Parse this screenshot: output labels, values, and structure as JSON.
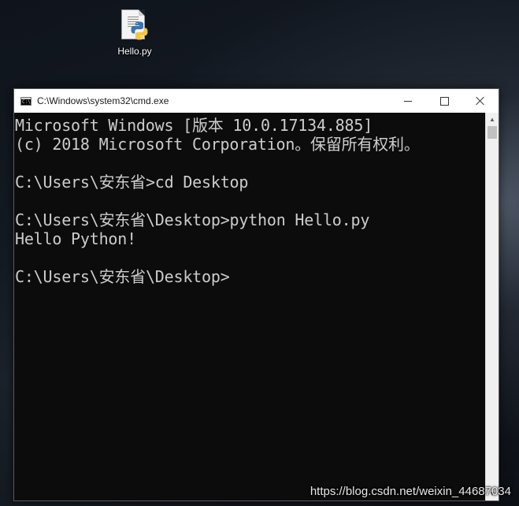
{
  "desktop": {
    "icon_label": "Hello.py",
    "icon_name": "python-file-icon"
  },
  "window": {
    "title": "C:\\Windows\\system32\\cmd.exe",
    "app_icon_text": "C:\\",
    "minimize_icon": "minimize-icon",
    "maximize_icon": "maximize-icon",
    "close_icon": "close-icon"
  },
  "console": {
    "lines": [
      "Microsoft Windows [版本 10.0.17134.885]",
      "(c) 2018 Microsoft Corporation。保留所有权利。",
      "",
      "C:\\Users\\安东省>cd Desktop",
      "",
      "C:\\Users\\安东省\\Desktop>python Hello.py",
      "Hello Python!",
      "",
      "C:\\Users\\安东省\\Desktop>"
    ],
    "text_color": "#cccccc",
    "background_color": "#0c0c0c"
  },
  "scrollbar": {
    "up_icon": "scroll-up-icon",
    "down_icon": "scroll-down-icon",
    "up_glyph": "▲",
    "down_glyph": "▼"
  },
  "watermark": "https://blog.csdn.net/weixin_44687034"
}
